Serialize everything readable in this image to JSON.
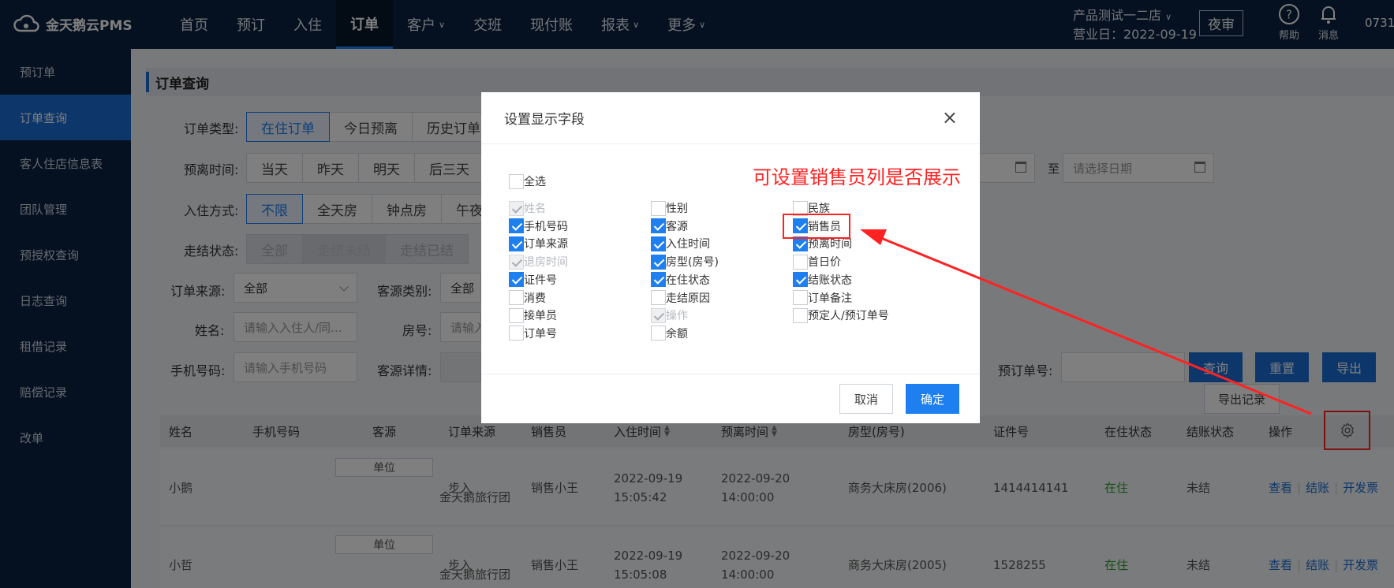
{
  "app": {
    "name": "金天鹅云PMS"
  },
  "nav": [
    {
      "label": "首页",
      "chevron": false
    },
    {
      "label": "预订",
      "chevron": false
    },
    {
      "label": "入住",
      "chevron": false
    },
    {
      "label": "订单",
      "chevron": false,
      "active": true
    },
    {
      "label": "客户",
      "chevron": true
    },
    {
      "label": "交班",
      "chevron": false
    },
    {
      "label": "现付账",
      "chevron": false
    },
    {
      "label": "报表",
      "chevron": true
    },
    {
      "label": "更多",
      "chevron": true
    }
  ],
  "header": {
    "hotel": "产品测试一二店",
    "business_day": "营业日：2022-09-19",
    "night_audit": "夜审",
    "help": "帮助",
    "messages": "消息",
    "user": "0731"
  },
  "sidebar": [
    {
      "label": "预订单"
    },
    {
      "label": "订单查询",
      "active": true
    },
    {
      "label": "客人住店信息表"
    },
    {
      "label": "团队管理"
    },
    {
      "label": "预授权查询"
    },
    {
      "label": "日志查询"
    },
    {
      "label": "租借记录"
    },
    {
      "label": "赔偿记录"
    },
    {
      "label": "改单"
    }
  ],
  "page": {
    "title": "订单查询",
    "filters": {
      "order_type_label": "订单类型:",
      "order_type": [
        "在住订单",
        "今日预离",
        "历史订单"
      ],
      "depart_label": "预离时间:",
      "depart": [
        "当天",
        "昨天",
        "明天",
        "后三天"
      ],
      "checkin_label": "入住方式:",
      "checkin": [
        "不限",
        "全天房",
        "钟点房",
        "午夜"
      ],
      "settle_label": "走结状态:",
      "settle": [
        "全部",
        "走结未结",
        "走结已结"
      ],
      "source_label": "订单来源:",
      "source_value": "全部",
      "category_label": "客源类别:",
      "category_value": "全部",
      "name_label": "姓名:",
      "name_placeholder": "请输入入住人/同...",
      "room_label": "房号:",
      "room_placeholder": "请输入",
      "phone_label": "手机号码:",
      "phone_placeholder": "请输入手机号码",
      "detail_label": "客源详情:",
      "date_to": "至",
      "date_placeholder": "请选择日期",
      "prebook_label": "预订单号:",
      "query": "查询",
      "reset": "重置",
      "export": "导出",
      "export_log": "导出记录"
    },
    "columns": [
      "姓名",
      "手机号码",
      "客源",
      "订单来源",
      "销售员",
      "入住时间",
      "预离时间",
      "房型(房号)",
      "证件号",
      "在住状态",
      "结账状态",
      "操作"
    ],
    "rows": [
      {
        "name": "小鹅",
        "tag": "单位",
        "source": "金天鹅旅行团",
        "channel": "步入",
        "sales": "销售小王",
        "in_date": "2022-09-19",
        "in_time": "15:05:42",
        "out_date": "2022-09-20",
        "out_time": "14:00:00",
        "room": "商务大床房(2006)",
        "id": "1414414141",
        "status": "在住",
        "bill": "未结"
      },
      {
        "name": "小哲",
        "tag": "单位",
        "source": "金天鹅旅行团",
        "channel": "步入",
        "sales": "销售小王",
        "in_date": "2022-09-19",
        "in_time": "15:05:08",
        "out_date": "2022-09-20",
        "out_time": "14:00:00",
        "room": "商务大床房(2005)",
        "id": "1528255",
        "status": "在住",
        "bill": "未结"
      }
    ],
    "actions": [
      "查看",
      "结账",
      "开发票"
    ]
  },
  "modal": {
    "title": "设置显示字段",
    "select_all": "全选",
    "col1": [
      {
        "label": "姓名",
        "state": "disabled-checked"
      },
      {
        "label": "手机号码",
        "state": "checked"
      },
      {
        "label": "订单来源",
        "state": "checked"
      },
      {
        "label": "退房时间",
        "state": "disabled-checked"
      },
      {
        "label": "证件号",
        "state": "checked"
      },
      {
        "label": "消费",
        "state": "unchecked"
      },
      {
        "label": "接单员",
        "state": "unchecked"
      },
      {
        "label": "订单号",
        "state": "unchecked"
      }
    ],
    "col2": [
      {
        "label": "性别",
        "state": "unchecked"
      },
      {
        "label": "客源",
        "state": "checked"
      },
      {
        "label": "入住时间",
        "state": "checked"
      },
      {
        "label": "房型(房号)",
        "state": "checked"
      },
      {
        "label": "在住状态",
        "state": "checked"
      },
      {
        "label": "走结原因",
        "state": "unchecked"
      },
      {
        "label": "操作",
        "state": "disabled-checked"
      },
      {
        "label": "余额",
        "state": "unchecked"
      }
    ],
    "col3": [
      {
        "label": "民族",
        "state": "unchecked"
      },
      {
        "label": "销售员",
        "state": "checked"
      },
      {
        "label": "预离时间",
        "state": "checked"
      },
      {
        "label": "首日价",
        "state": "unchecked"
      },
      {
        "label": "结账状态",
        "state": "checked"
      },
      {
        "label": "订单备注",
        "state": "unchecked"
      },
      {
        "label": "预定人/预订单号",
        "state": "unchecked"
      }
    ],
    "cancel": "取消",
    "ok": "确定"
  },
  "annotation": {
    "text": "可设置销售员列是否展示",
    "color": "#ff2222"
  },
  "colors": {
    "nav_bg": "#0b2140",
    "accent": "#1e7ff0"
  }
}
